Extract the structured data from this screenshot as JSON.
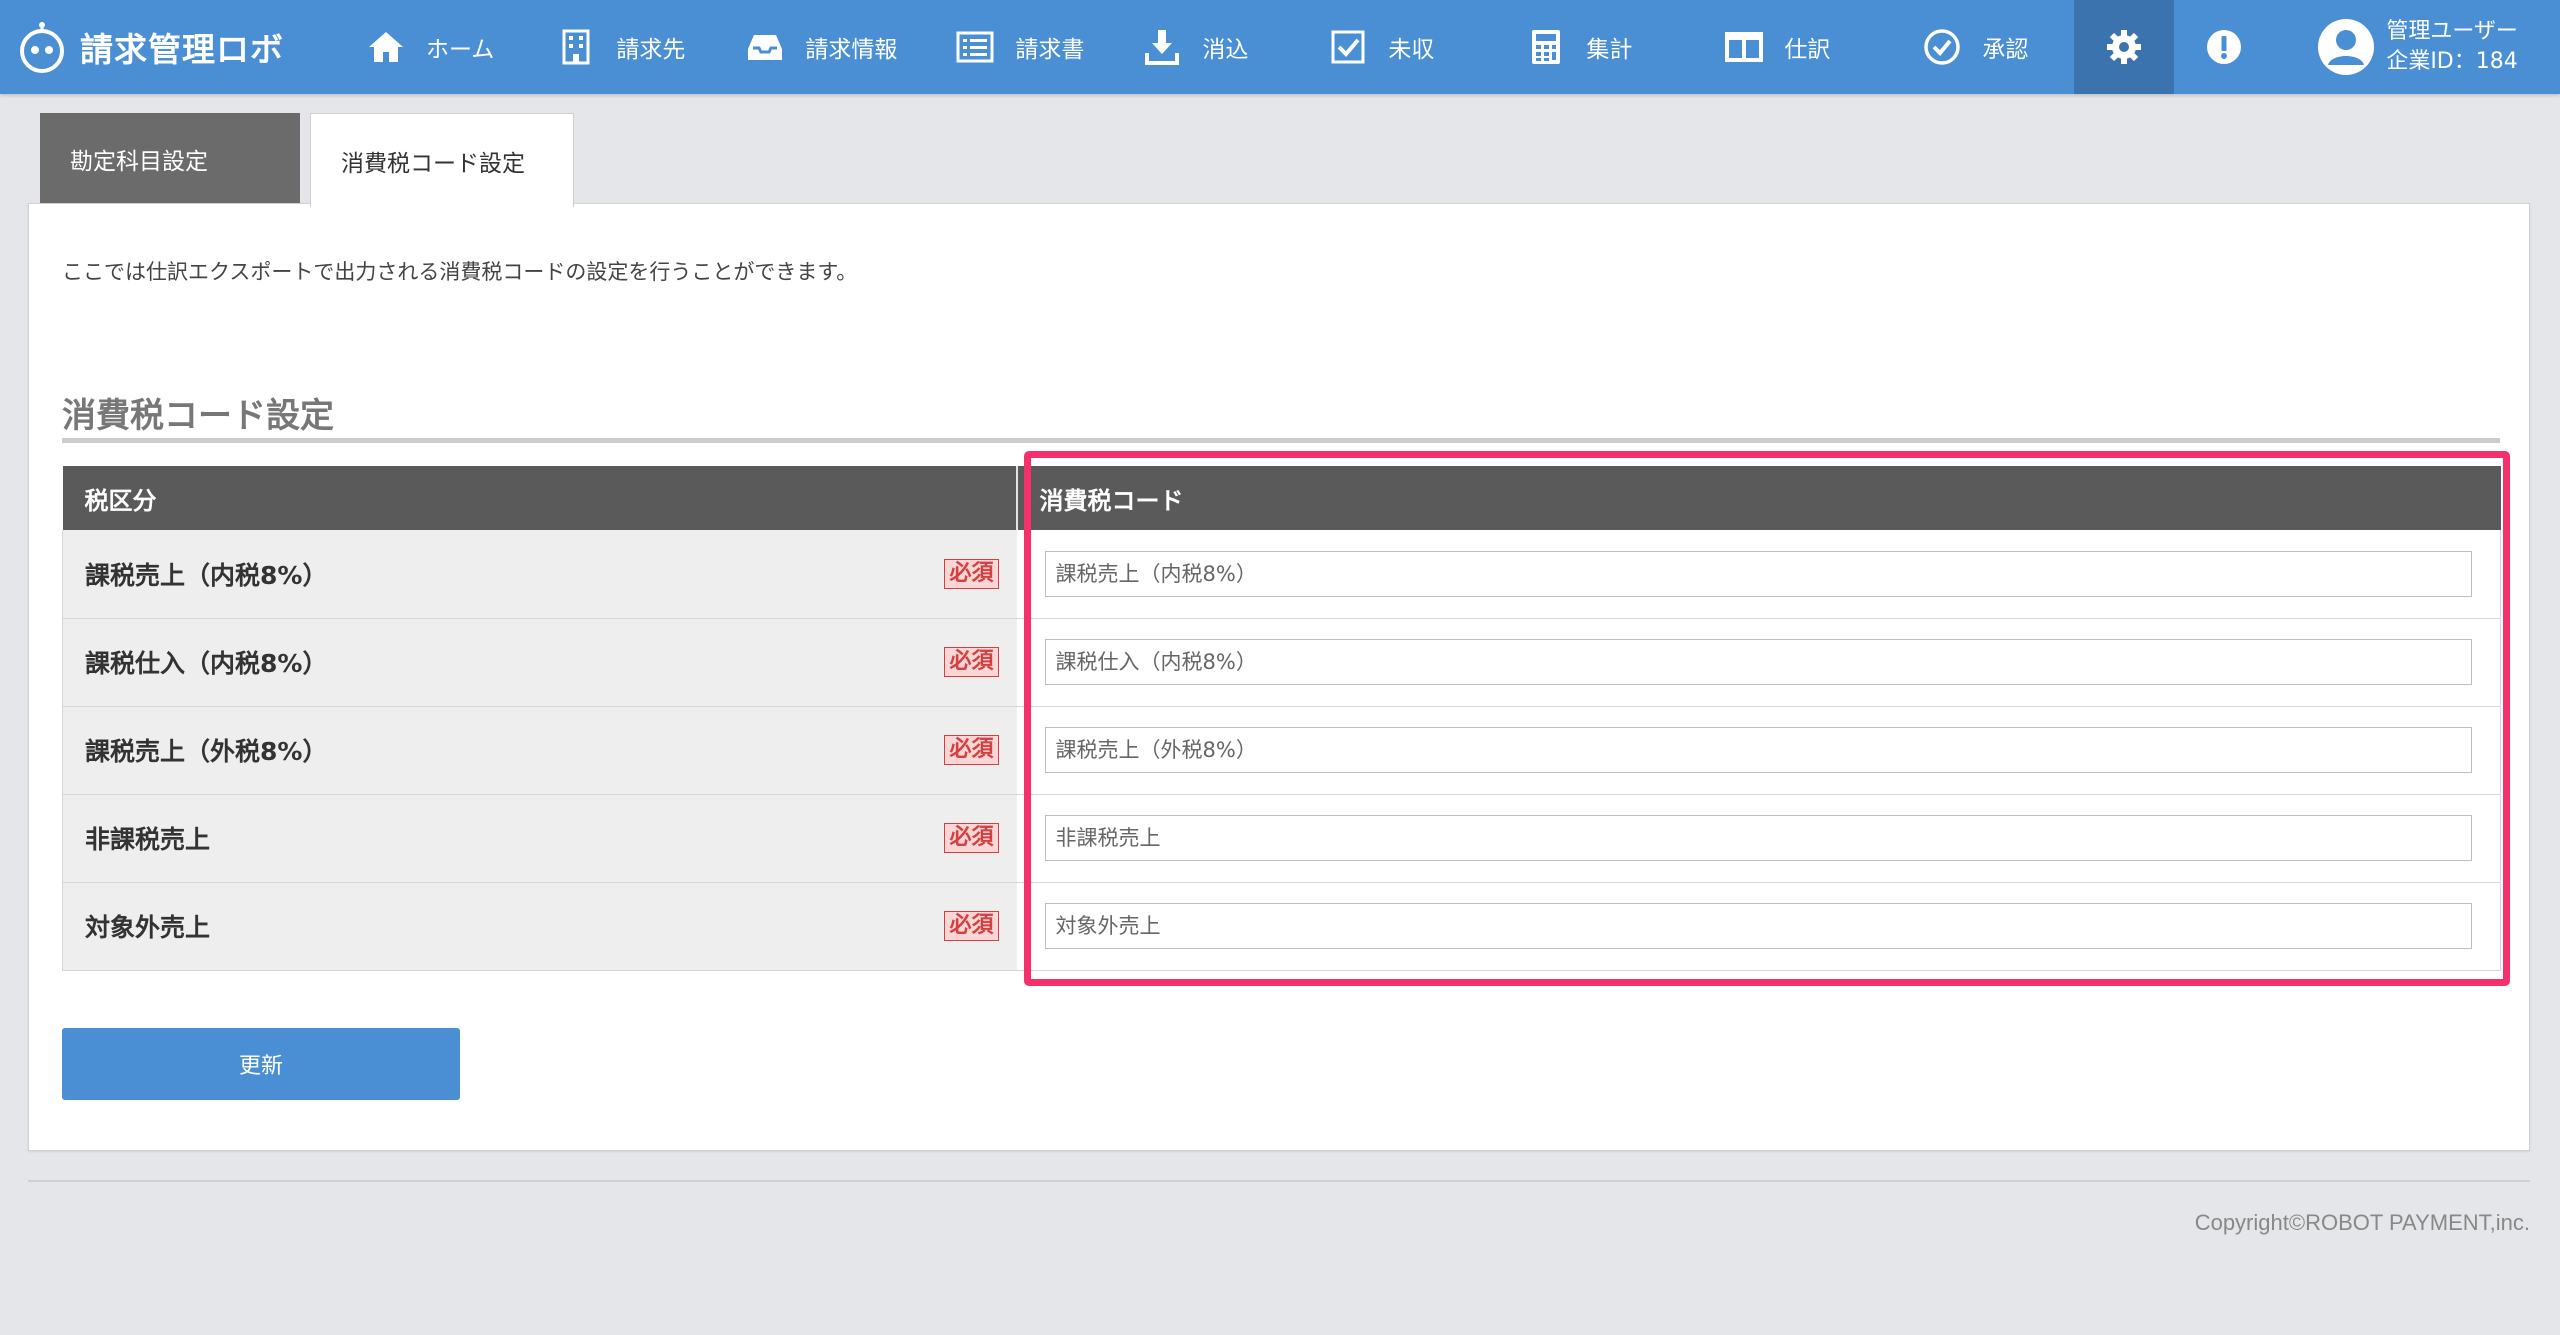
{
  "app": {
    "logo_text": "請求管理ロボ",
    "brand_color": "#4a8fd3",
    "accent_highlight": "#f6306b"
  },
  "nav": {
    "items": [
      {
        "label": "ホーム",
        "icon": "home-icon"
      },
      {
        "label": "請求先",
        "icon": "building-icon"
      },
      {
        "label": "請求情報",
        "icon": "inbox-icon"
      },
      {
        "label": "請求書",
        "icon": "list-icon"
      },
      {
        "label": "消込",
        "icon": "download-icon"
      },
      {
        "label": "未収",
        "icon": "checkbox-icon"
      },
      {
        "label": "集計",
        "icon": "calculator-icon"
      },
      {
        "label": "仕訳",
        "icon": "columns-icon"
      },
      {
        "label": "承認",
        "icon": "check-circle-icon"
      }
    ],
    "settings_icon": "gear-icon",
    "alert_icon": "exclamation-icon",
    "user": {
      "name": "管理ユーザー",
      "company_id": "企業ID：184"
    }
  },
  "tabs": [
    {
      "label": "勘定科目設定",
      "active": false
    },
    {
      "label": "消費税コード設定",
      "active": true
    }
  ],
  "main": {
    "description": "ここでは仕訳エクスポートで出力される消費税コードの設定を行うことができます。",
    "section_title": "消費税コード設定",
    "table": {
      "headers": [
        "税区分",
        "消費税コード"
      ],
      "required_label": "必須",
      "rows": [
        {
          "label": "課税売上（内税8%）",
          "placeholder": "課税売上（内税8%）"
        },
        {
          "label": "課税仕入（内税8%）",
          "placeholder": "課税仕入（内税8%）"
        },
        {
          "label": "課税売上（外税8%）",
          "placeholder": "課税売上（外税8%）"
        },
        {
          "label": "非課税売上",
          "placeholder": "非課税売上"
        },
        {
          "label": "対象外売上",
          "placeholder": "対象外売上"
        }
      ]
    },
    "update_button": "更新"
  },
  "footer": {
    "copyright": "Copyright©ROBOT PAYMENT,inc."
  }
}
